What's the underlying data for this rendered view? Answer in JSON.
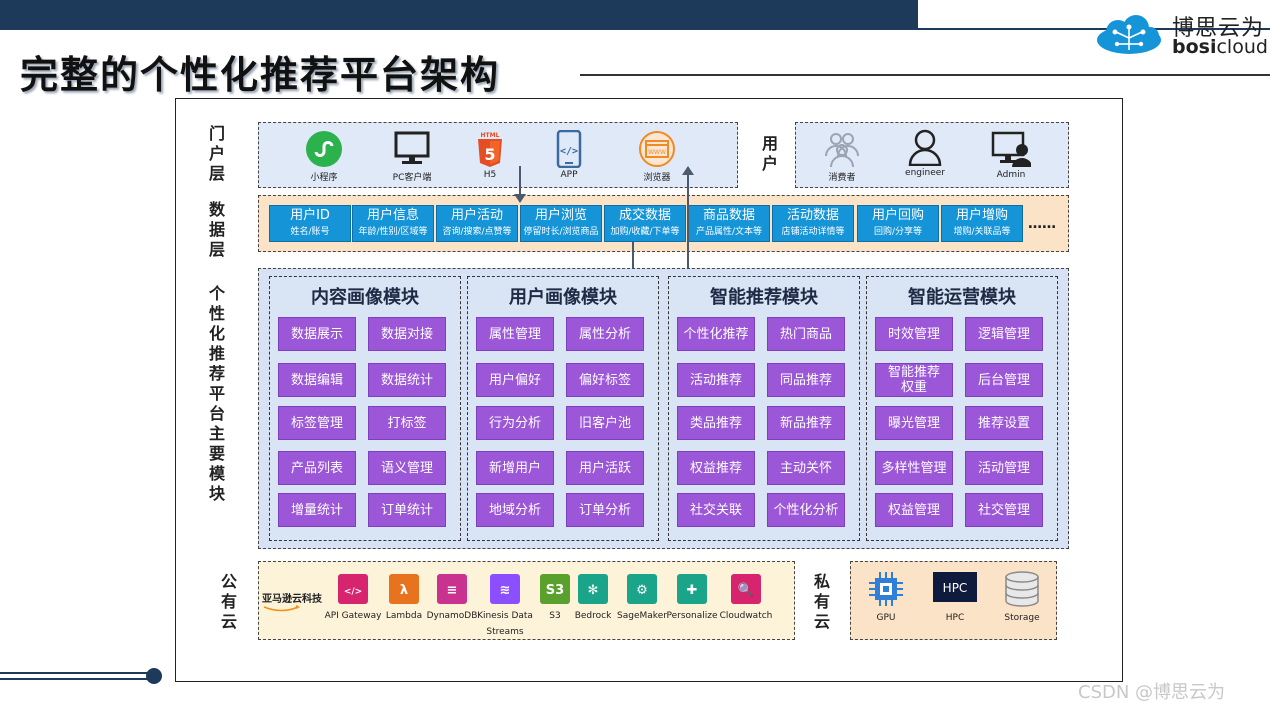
{
  "title": "完整的个性化推荐平台架构",
  "logo": {
    "cn": "博思云为",
    "en_bold": "bosi",
    "en_rest": "cloud"
  },
  "layers": {
    "portal": "门户层",
    "data": "数据层",
    "modules": "个性化推荐平台主要模块",
    "public_cloud": "公有云",
    "private_cloud": "私有云"
  },
  "portal": {
    "clients": [
      {
        "icon": "miniprogram-icon",
        "label": "小程序",
        "color": "#2bb24c"
      },
      {
        "icon": "pc-monitor-icon",
        "label": "PC客户端",
        "color": "#222222"
      },
      {
        "icon": "html5-icon",
        "label": "H5",
        "color": "#e44d26"
      },
      {
        "icon": "mobile-app-icon",
        "label": "APP",
        "color": "#3b6aa0"
      },
      {
        "icon": "browser-icon",
        "label": "浏览器",
        "color": "#f08a24"
      }
    ],
    "user_label": "用户",
    "users": [
      {
        "icon": "consumers-icon",
        "label": "消费者"
      },
      {
        "icon": "engineer-icon",
        "label": "engineer"
      },
      {
        "icon": "admin-icon",
        "label": "Admin"
      }
    ]
  },
  "data_layer": {
    "items": [
      {
        "title": "用户ID",
        "sub": "姓名/账号"
      },
      {
        "title": "用户信息",
        "sub": "年龄/性别/区域等"
      },
      {
        "title": "用户活动",
        "sub": "咨询/搜索/点赞等"
      },
      {
        "title": "用户浏览",
        "sub": "停留时长/浏览商品"
      },
      {
        "title": "成交数据",
        "sub": "加购/收藏/下单等"
      },
      {
        "title": "商品数据",
        "sub": "产品属性/文本等"
      },
      {
        "title": "活动数据",
        "sub": "店铺活动详情等"
      },
      {
        "title": "用户回购",
        "sub": "回购/分享等"
      },
      {
        "title": "用户增购",
        "sub": "增购/关联品等"
      }
    ],
    "more": "……"
  },
  "modules": [
    {
      "title": "内容画像模块",
      "items": [
        "数据展示",
        "数据对接",
        "数据编辑",
        "数据统计",
        "标签管理",
        "打标签",
        "产品列表",
        "语义管理",
        "增量统计",
        "订单统计"
      ]
    },
    {
      "title": "用户画像模块",
      "items": [
        "属性管理",
        "属性分析",
        "用户偏好",
        "偏好标签",
        "行为分析",
        "旧客户池",
        "新增用户",
        "用户活跃",
        "地域分析",
        "订单分析"
      ]
    },
    {
      "title": "智能推荐模块",
      "items": [
        "个性化推荐",
        "热门商品",
        "活动推荐",
        "同品推荐",
        "类品推荐",
        "新品推荐",
        "权益推荐",
        "主动关怀",
        "社交关联",
        "个性化分析"
      ]
    },
    {
      "title": "智能运营模块",
      "items": [
        "时效管理",
        "逻辑管理",
        "智能推荐权重",
        "后台管理",
        "曝光管理",
        "推荐设置",
        "多样性管理",
        "活动管理",
        "权益管理",
        "社交管理"
      ]
    }
  ],
  "public_cloud": {
    "provider": "亚马逊云科技",
    "services": [
      {
        "icon": "api-gateway-icon",
        "label": "API Gateway",
        "color": "#d6246e"
      },
      {
        "icon": "lambda-icon",
        "label": "Lambda",
        "color": "#e8731f"
      },
      {
        "icon": "dynamodb-icon",
        "label": "DynamoDB",
        "color": "#c9338f"
      },
      {
        "icon": "kinesis-icon",
        "label": "Kinesis Data Streams",
        "color": "#8c4fff"
      },
      {
        "icon": "s3-icon",
        "label": "S3",
        "color": "#5aa02c"
      },
      {
        "icon": "bedrock-icon",
        "label": "Bedrock",
        "color": "#1aa58a"
      },
      {
        "icon": "sagemaker-icon",
        "label": "SageMaker",
        "color": "#1aa58a"
      },
      {
        "icon": "personalize-icon",
        "label": "Personalize",
        "color": "#1aa58a"
      },
      {
        "icon": "cloudwatch-icon",
        "label": "Cloudwatch",
        "color": "#d6246e"
      }
    ]
  },
  "private_cloud": {
    "items": [
      {
        "icon": "gpu-icon",
        "label": "GPU"
      },
      {
        "icon": "hpc-icon",
        "label": "HPC",
        "badge": "HPC"
      },
      {
        "icon": "storage-icon",
        "label": "Storage"
      }
    ]
  },
  "watermark": "CSDN @博思云为"
}
